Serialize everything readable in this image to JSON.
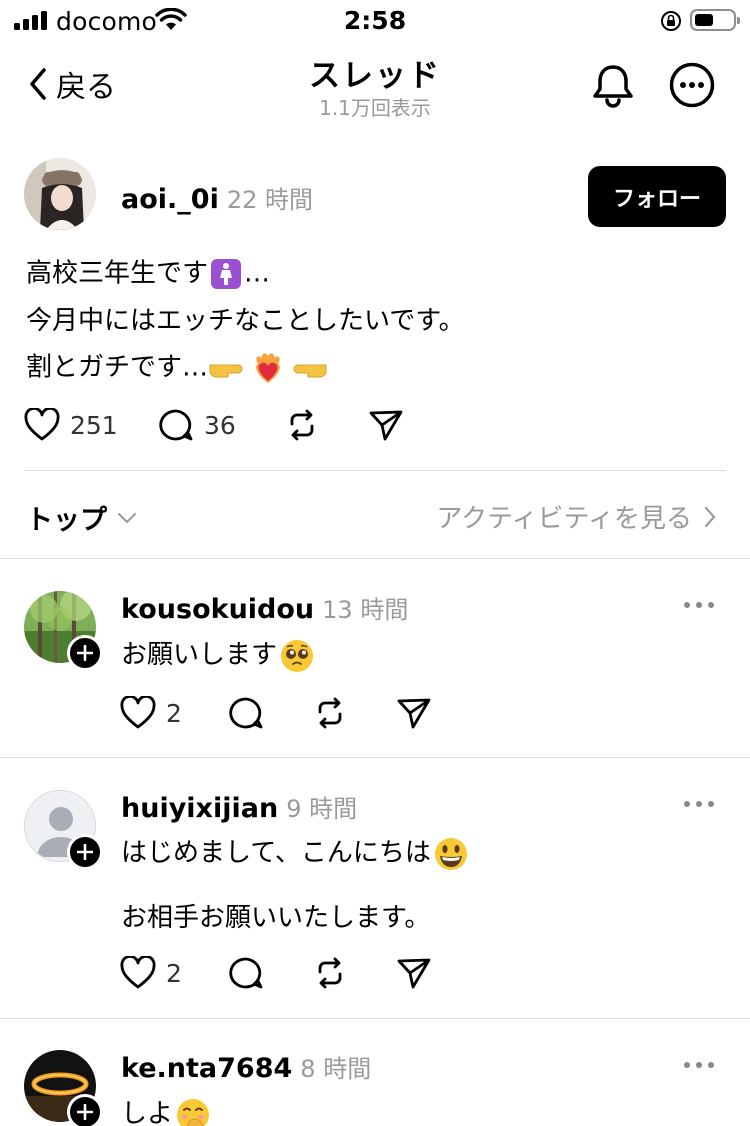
{
  "status_bar": {
    "carrier": "docomo",
    "time": "2:58"
  },
  "nav": {
    "back_label": "戻る",
    "title": "スレッド",
    "views": "1.1万回表示"
  },
  "post": {
    "username": "aoi._0i",
    "time": "22 時間",
    "follow_label": "フォロー",
    "lines": [
      "高校三年生です",
      "…",
      "今月中にはエッチなことしたいです。",
      "割とガチです…"
    ],
    "likes": "251",
    "replies": "36"
  },
  "sort": {
    "label": "トップ",
    "activity_label": "アクティビティを見る"
  },
  "replies": [
    {
      "username": "kousokuidou",
      "time": "13 時間",
      "text": "お願いします",
      "likes": "2"
    },
    {
      "username": "huiyixijian",
      "time": "9 時間",
      "text": "はじめまして、こんにちは",
      "text2": "お相手お願いいたします。",
      "likes": "2"
    },
    {
      "username": "ke.nta7684",
      "time": "8 時間",
      "text": "しよ"
    }
  ],
  "colors": {
    "accent": "#000000",
    "muted": "#9a9a9a",
    "divider": "#dcdcdc"
  }
}
